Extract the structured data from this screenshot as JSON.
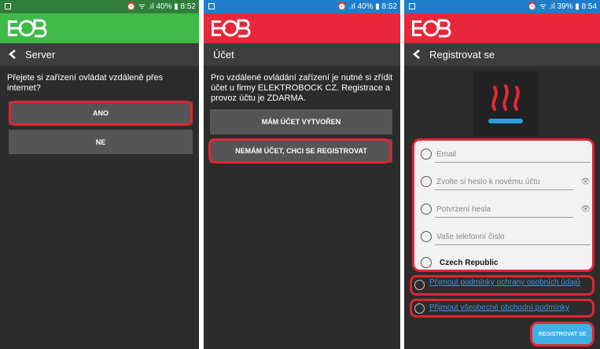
{
  "screens": [
    {
      "status_time": "8:52",
      "status_battery": "40%",
      "brand_color": "#3fba49",
      "title": "Server",
      "prompt": "Přejete si zařízení ovládat vzdáleně přes internet?",
      "buttons": [
        "ANO",
        "NE"
      ]
    },
    {
      "status_time": "8:52",
      "status_battery": "40%",
      "brand_color": "#e8283a",
      "title": "Účet",
      "prompt": "Pro vzdálené ovládání zařízení je nutné si zřídit účet u firmy ELEKTROBOCK CZ. Registrace a provoz účtu je ZDARMA.",
      "buttons": [
        "MÁM ÚČET VYTVOŘEN",
        "NEMÁM ÚČET, CHCI SE REGISTROVAT"
      ]
    },
    {
      "status_time": "8:54",
      "status_battery": "39%",
      "brand_color": "#e8283a",
      "title": "Registrovat se",
      "fields": [
        {
          "placeholder": "Email",
          "icon": "email-icon"
        },
        {
          "placeholder": "Zvolte si heslo k novému účtu",
          "icon": "lock-icon"
        },
        {
          "placeholder": "Potvrzení hesla",
          "icon": "lock-icon"
        },
        {
          "placeholder": "Vaše telefonní číslo",
          "icon": "phone-icon"
        },
        {
          "placeholder": "Czech Republic",
          "icon": "location-icon"
        }
      ],
      "checkboxes": [
        "Přijmout podmínky ochrany osobních údajů",
        "Přijmout všeobecné obchodní podmínky"
      ],
      "register_button": "REGISTROVAT SE",
      "highlight_color": "#e0262f"
    }
  ]
}
